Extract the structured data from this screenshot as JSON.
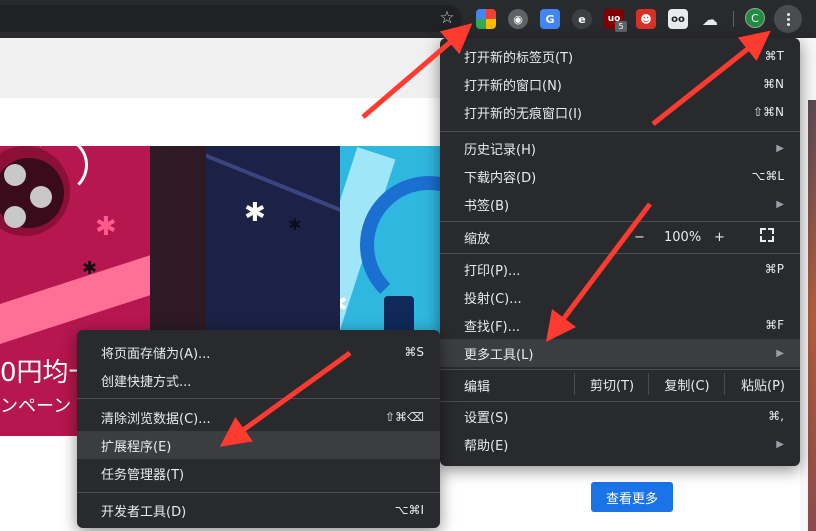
{
  "chrome_menu": {
    "new_tab": {
      "label": "打开新的标签页(T)",
      "shortcut": "⌘T"
    },
    "new_window": {
      "label": "打开新的窗口(N)",
      "shortcut": "⌘N"
    },
    "new_incognito": {
      "label": "打开新的无痕窗口(I)",
      "shortcut": "⇧⌘N"
    },
    "history": {
      "label": "历史记录(H)"
    },
    "downloads": {
      "label": "下载内容(D)",
      "shortcut": "⌥⌘L"
    },
    "bookmarks": {
      "label": "书签(B)"
    },
    "zoom": {
      "label": "缩放",
      "minus": "−",
      "value": "100%",
      "plus": "+"
    },
    "print": {
      "label": "打印(P)...",
      "shortcut": "⌘P"
    },
    "cast": {
      "label": "投射(C)..."
    },
    "find": {
      "label": "查找(F)...",
      "shortcut": "⌘F"
    },
    "more_tools": {
      "label": "更多工具(L)"
    },
    "edit": {
      "label": "编辑",
      "cut": "剪切(T)",
      "copy": "复制(C)",
      "paste": "粘贴(P)"
    },
    "settings": {
      "label": "设置(S)",
      "shortcut": "⌘,"
    },
    "help": {
      "label": "帮助(E)"
    }
  },
  "more_tools_menu": {
    "save_page": {
      "label": "将页面存储为(A)...",
      "shortcut": "⌘S"
    },
    "create_shortcut": {
      "label": "创建快捷方式..."
    },
    "clear_data": {
      "label": "清除浏览数据(C)...",
      "shortcut": "⇧⌘⌫"
    },
    "extensions": {
      "label": "扩展程序(E)"
    },
    "task_manager": {
      "label": "任务管理器(T)"
    },
    "dev_tools": {
      "label": "开发者工具(D)",
      "shortcut": "⌥⌘I"
    }
  },
  "toolbar": {
    "profile_initial": "C",
    "extension_badge": "5"
  },
  "page": {
    "banner_text_1": "0円均一",
    "banner_text_2": "ンペーン",
    "see_more_label": "查看更多"
  },
  "colors": {
    "menu_bg": "#292a2d",
    "menu_highlight": "#3c3d41",
    "accent_blue": "#1a73e8",
    "arrow_red": "#ff3b30"
  }
}
